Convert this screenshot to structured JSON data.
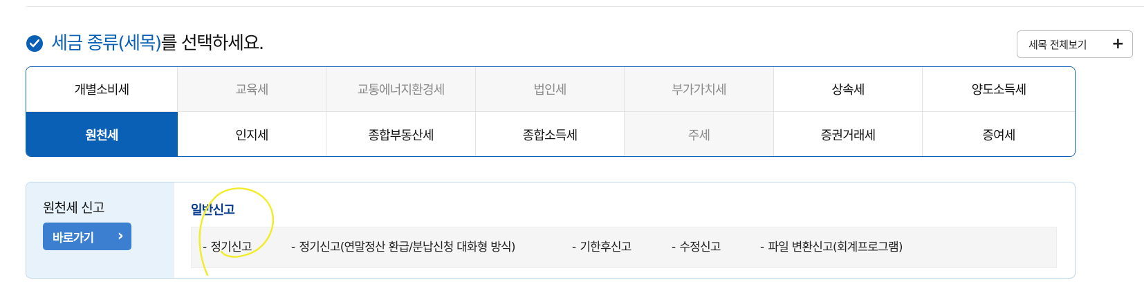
{
  "heading": {
    "highlight": "세금 종류(세목)",
    "rest": "를 선택하세요.",
    "all_button_label": "세목 전체보기"
  },
  "tax_types": [
    {
      "label": "개별소비세",
      "state": "normal"
    },
    {
      "label": "교육세",
      "state": "disabled"
    },
    {
      "label": "교통에너지환경세",
      "state": "disabled"
    },
    {
      "label": "법인세",
      "state": "disabled"
    },
    {
      "label": "부가가치세",
      "state": "disabled"
    },
    {
      "label": "상속세",
      "state": "normal"
    },
    {
      "label": "양도소득세",
      "state": "normal"
    },
    {
      "label": "원천세",
      "state": "active"
    },
    {
      "label": "인지세",
      "state": "normal"
    },
    {
      "label": "종합부동산세",
      "state": "normal"
    },
    {
      "label": "종합소득세",
      "state": "normal"
    },
    {
      "label": "주세",
      "state": "disabled"
    },
    {
      "label": "증권거래세",
      "state": "normal"
    },
    {
      "label": "증여세",
      "state": "normal"
    }
  ],
  "report_panel": {
    "side_title": "원천세 신고",
    "go_button_label": "바로가기",
    "sub_title": "일반신고",
    "items": [
      "정기신고",
      "정기신고(연말정산 환급/분납신청 대화형 방식)",
      "기한후신고",
      "수정신고",
      "파일 변환신고(회계프로그램)"
    ]
  },
  "colors": {
    "brand": "#0a60b5",
    "disabled_bg": "#f7f7f7",
    "side_bg": "#e7f2fb",
    "annotation": "#f2ec2e"
  },
  "icons": {
    "heading": "check-circle-icon",
    "all_button": "plus-icon",
    "go_button": "chevron-right-icon"
  }
}
